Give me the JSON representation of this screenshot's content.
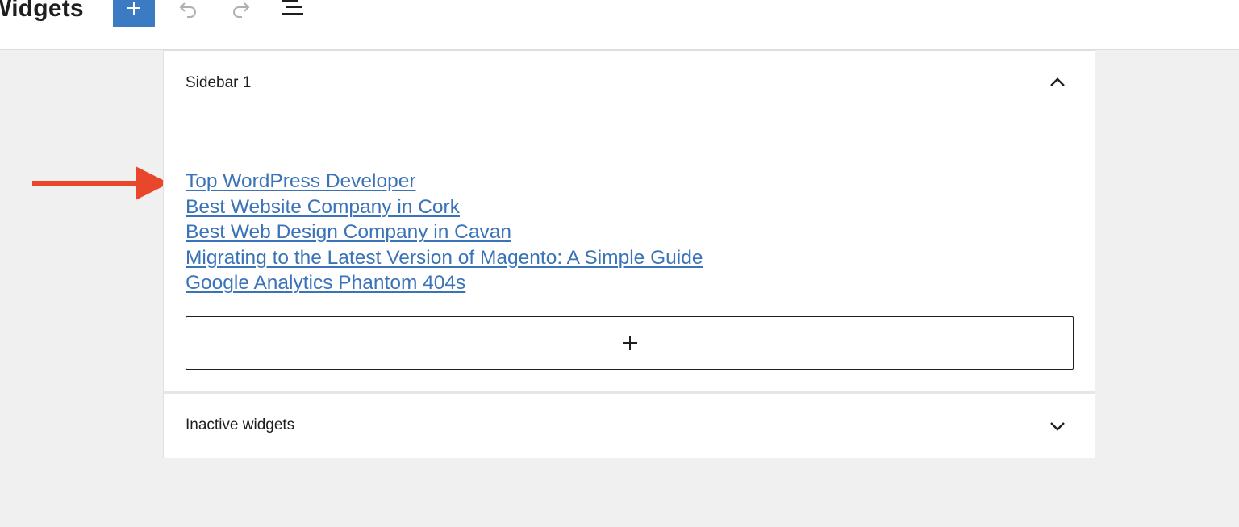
{
  "header": {
    "title": "Widgets",
    "add_button_label": "+",
    "undo_icon": "undo-icon",
    "redo_icon": "redo-icon",
    "list_view_icon": "list-view-icon"
  },
  "sidebar": {
    "title": "Sidebar 1",
    "toggle_icon": "chevron-up-icon",
    "links": [
      "Top WordPress Developer",
      "Best Website Company in Cork",
      "Best Web Design Company in Cavan",
      "Migrating to the Latest Version of Magento: A Simple Guide",
      "Google Analytics Phantom 404s"
    ],
    "appender_label": "+"
  },
  "inactive": {
    "title": "Inactive widgets",
    "toggle_icon": "chevron-down-icon"
  },
  "annotation": {
    "arrow_color": "#e8472c"
  },
  "colors": {
    "accent": "#3a7bc4",
    "link": "#3a73b7"
  }
}
